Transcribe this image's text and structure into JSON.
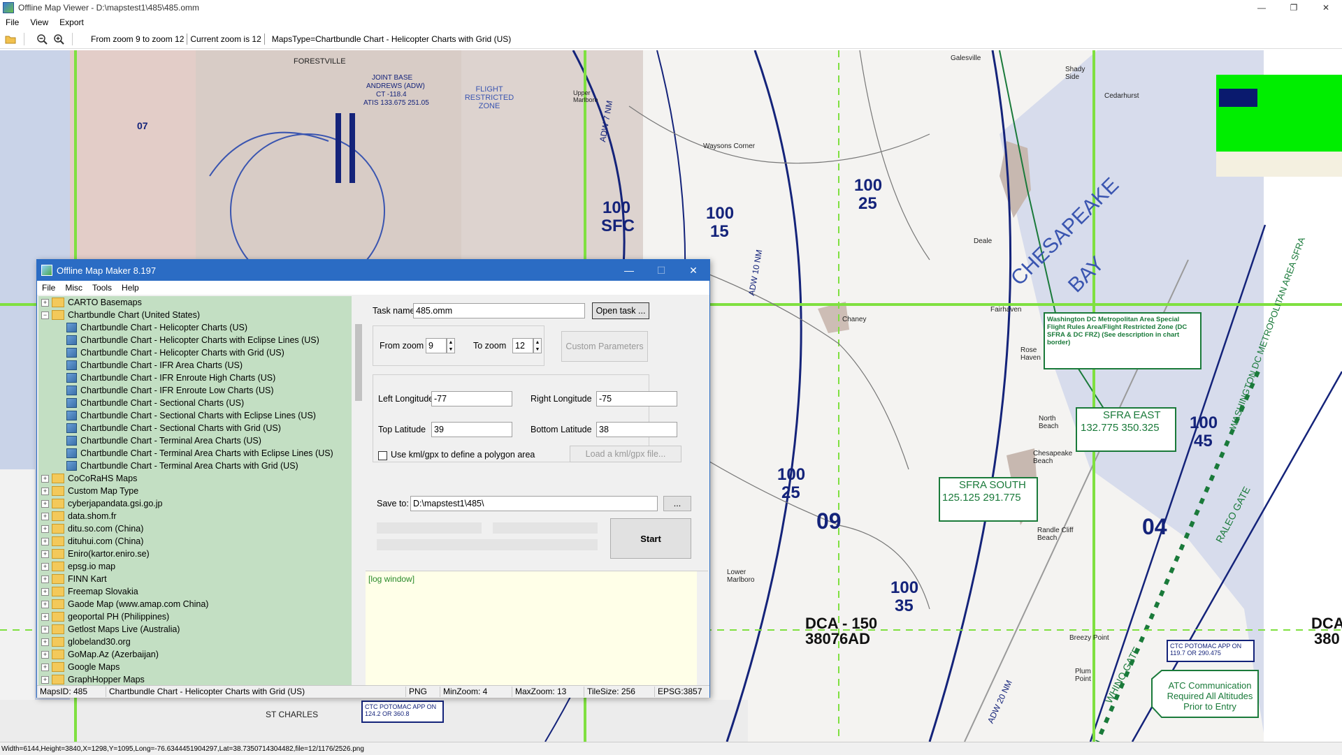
{
  "window": {
    "title": "Offline Map Viewer - D:\\mapstest1\\485\\485.omm"
  },
  "menu": [
    "File",
    "View",
    "Export"
  ],
  "toolbar": {
    "zoom_range": "From zoom 9 to zoom 12",
    "current_zoom": "Current zoom is 12",
    "maps_type": "MapsType=Chartbundle Chart - Helicopter Charts with Grid (US)"
  },
  "status_bar": "Width=6144,Height=3840,X=1298,Y=1095,Long=-76.6344451904297,Lat=38.7350714304482,file=12/1176/2526.png",
  "map_labels": {
    "forestville": "FORESTVILLE",
    "joint_base": "JOINT BASE",
    "andrews": "ANDREWS (ADW)",
    "ct": "CT -118.4",
    "atis": "ATIS 133.675 251.05",
    "flight_restricted": "FLIGHT RESTRICTED ZONE",
    "upper_marlboro": "Upper Marlboro",
    "galesville": "Galesville",
    "shady_side": "Shady Side",
    "cedarhurst": "Cedarhurst",
    "waysons": "Waysons Corner",
    "chesapeake": "CHESAPEAKE",
    "bay": "BAY",
    "chaney": "Chaney",
    "fairhaven": "Fairhaven",
    "deale": "Deale",
    "rose_haven": "Rose Haven",
    "north_beach": "North Beach",
    "chesapeake_beach": "Chesapeake Beach",
    "randle_cliff": "Randle Cliff Beach",
    "lower_marlboro": "Lower Marlboro",
    "breezy_point": "Breezy Point",
    "plum_point": "Plum Point",
    "st_charles": "ST CHARLES",
    "sfra_note": "Washington DC Metropolitan Area Special Flight Rules Area/Flight Restricted Zone (DC SFRA & DC FRZ) (See description in chart border)",
    "sfra_east_title": "SFRA EAST",
    "sfra_east_freq": "132.775  350.325",
    "sfra_south_title": "SFRA SOUTH",
    "sfra_south_freq": "125.125  291.775",
    "ctc_potomac_1": "CTC POTOMAC APP ON 119.7 OR 290.475",
    "ctc_potomac_2": "CTC POTOMAC APP ON 124.2 OR 360.8",
    "atc_comm": "ATC Communication Required All Altitudes Prior to Entry",
    "dca_150": "DCA - 150",
    "dca_code": "38076AD",
    "dca_right": "DCA",
    "dca_right2": "380",
    "adw_7": "ADW 7 NM",
    "adw_10": "ADW 10 NM",
    "adw_20": "ADW 20 NM",
    "waldorf_gate": "WHINO GATE",
    "raleo_gate": "RALEO GATE",
    "wash_metro": "WASHINGTON DC METROPOLITAN AREA SFRA",
    "alt_100_15a": "100",
    "alt_100_15b": "15",
    "alt_100_25a": "100",
    "alt_100_25b": "25",
    "alt_100_sfc": "100",
    "alt_sfc": "SFC",
    "alt_100_25c": "100",
    "alt_100_25d": "25",
    "alt_100_35a": "100",
    "alt_100_35b": "35",
    "alt_100_45a": "100",
    "alt_100_45b": "45",
    "label_09": "09",
    "label_04": "04",
    "label_07": "07"
  },
  "dialog": {
    "title": "Offline Map Maker 8.197",
    "menu": [
      "File",
      "Misc",
      "Tools",
      "Help"
    ],
    "tree": [
      {
        "type": "folder",
        "expanded": false,
        "label": "CARTO Basemaps"
      },
      {
        "type": "folder",
        "expanded": true,
        "label": "Chartbundle Chart (United States)"
      },
      {
        "type": "leaf",
        "label": "Chartbundle Chart - Helicopter Charts (US)"
      },
      {
        "type": "leaf",
        "label": "Chartbundle Chart - Helicopter Charts with Eclipse Lines (US)"
      },
      {
        "type": "leaf",
        "label": "Chartbundle Chart - Helicopter Charts with Grid (US)"
      },
      {
        "type": "leaf",
        "label": "Chartbundle Chart - IFR Area Charts (US)"
      },
      {
        "type": "leaf",
        "label": "Chartbundle Chart - IFR Enroute High Charts (US)"
      },
      {
        "type": "leaf",
        "label": "Chartbundle Chart - IFR Enroute Low Charts (US)"
      },
      {
        "type": "leaf",
        "label": "Chartbundle Chart - Sectional Charts (US)"
      },
      {
        "type": "leaf",
        "label": "Chartbundle Chart - Sectional Charts with Eclipse Lines (US)"
      },
      {
        "type": "leaf",
        "label": "Chartbundle Chart - Sectional Charts with Grid (US)"
      },
      {
        "type": "leaf",
        "label": "Chartbundle Chart - Terminal Area Charts (US)"
      },
      {
        "type": "leaf",
        "label": "Chartbundle Chart - Terminal Area Charts with Eclipse Lines (US)"
      },
      {
        "type": "leaf",
        "label": "Chartbundle Chart - Terminal Area Charts with Grid (US)"
      },
      {
        "type": "folder",
        "expanded": false,
        "label": "CoCoRaHS Maps"
      },
      {
        "type": "folder",
        "expanded": false,
        "label": "Custom Map Type"
      },
      {
        "type": "folder",
        "expanded": false,
        "label": "cyberjapandata.gsi.go.jp"
      },
      {
        "type": "folder",
        "expanded": false,
        "label": "data.shom.fr"
      },
      {
        "type": "folder",
        "expanded": false,
        "label": "ditu.so.com (China)"
      },
      {
        "type": "folder",
        "expanded": false,
        "label": "dituhui.com (China)"
      },
      {
        "type": "folder",
        "expanded": false,
        "label": "Eniro(kartor.eniro.se)"
      },
      {
        "type": "folder",
        "expanded": false,
        "label": "epsg.io map"
      },
      {
        "type": "folder",
        "expanded": false,
        "label": "FINN Kart"
      },
      {
        "type": "folder",
        "expanded": false,
        "label": "Freemap Slovakia"
      },
      {
        "type": "folder",
        "expanded": false,
        "label": "Gaode Map (www.amap.com China)"
      },
      {
        "type": "folder",
        "expanded": false,
        "label": "geoportal PH (Philippines)"
      },
      {
        "type": "folder",
        "expanded": false,
        "label": "Getlost Maps Live (Australia)"
      },
      {
        "type": "folder",
        "expanded": false,
        "label": "globeland30.org"
      },
      {
        "type": "folder",
        "expanded": false,
        "label": "GoMap.Az (Azerbaijan)"
      },
      {
        "type": "folder",
        "expanded": false,
        "label": "Google Maps"
      },
      {
        "type": "folder",
        "expanded": false,
        "label": "GraphHopper Maps"
      }
    ],
    "task_name_label": "Task name",
    "task_name_value": "485.omm",
    "open_task_button": "Open task ...",
    "from_zoom_label": "From zoom",
    "from_zoom_value": "9",
    "to_zoom_label": "To zoom",
    "to_zoom_value": "12",
    "custom_params_button": "Custom Parameters",
    "left_lon_label": "Left Longitude",
    "left_lon_value": "-77",
    "right_lon_label": "Right Longitude",
    "right_lon_value": "-75",
    "top_lat_label": "Top Latitude",
    "top_lat_value": "39",
    "bottom_lat_label": "Bottom Latitude",
    "bottom_lat_value": "38",
    "kml_checkbox_label": "Use kml/gpx to define a polygon area",
    "load_kml_button": "Load a kml/gpx file...",
    "save_to_label": "Save to:",
    "save_to_value": "D:\\mapstest1\\485\\",
    "browse_button": "...",
    "start_button": "Start",
    "log_text": "[log window]",
    "status": {
      "maps_id": "MapsID: 485",
      "map_name": "Chartbundle Chart - Helicopter Charts with Grid (US)",
      "format": "PNG",
      "min_zoom": "MinZoom: 4",
      "max_zoom": "MaxZoom: 13",
      "tile_size": "TileSize: 256",
      "epsg": "EPSG:3857"
    }
  },
  "colors": {
    "dialog_accent": "#2b6cc4",
    "tree_bg": "#c3dfc3",
    "grid_green": "#7fe040",
    "chart_navy": "#14237a",
    "chart_green": "#1a7a3a"
  }
}
